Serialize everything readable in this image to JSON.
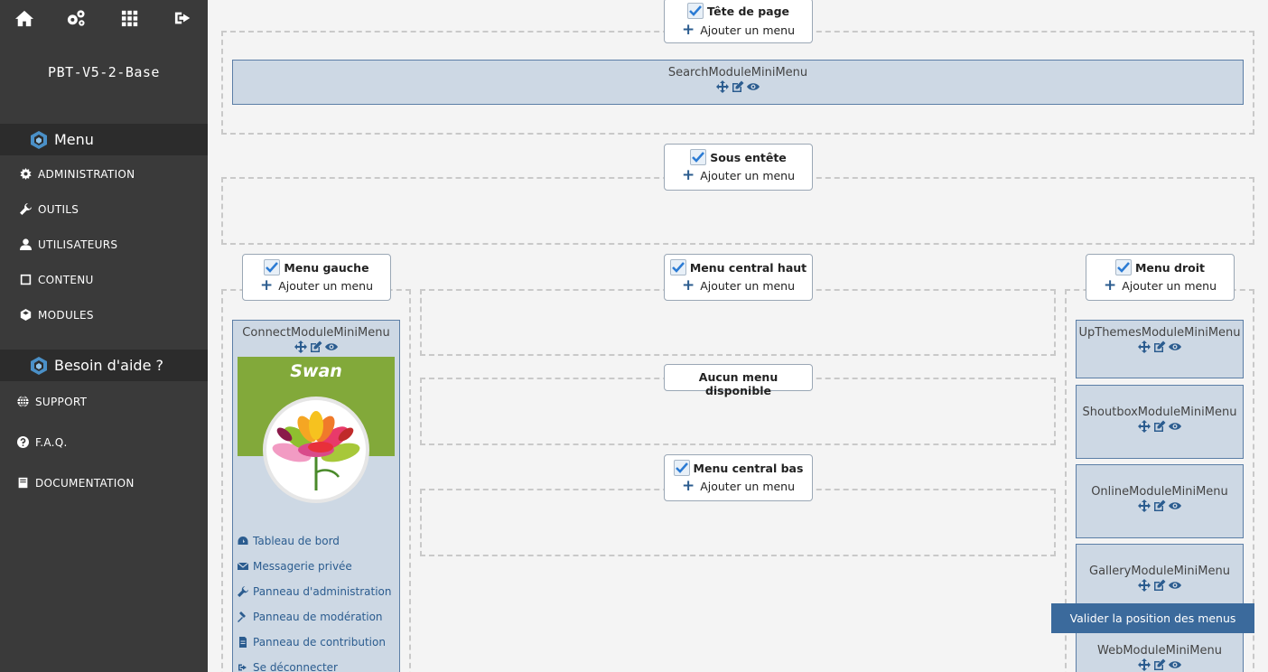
{
  "sidebar": {
    "top_icons": [
      "home-icon",
      "cogs-icon",
      "grid-icon",
      "sign-out-icon"
    ],
    "site_name": "PBT-V5-2-Base",
    "menu_title": "Menu",
    "menu_items": [
      {
        "label": "ADMINISTRATION",
        "icon": "gear-icon"
      },
      {
        "label": "OUTILS",
        "icon": "wrench-icon"
      },
      {
        "label": "UTILISATEURS",
        "icon": "user-icon"
      },
      {
        "label": "CONTENU",
        "icon": "square-icon"
      },
      {
        "label": "MODULES",
        "icon": "cube-icon"
      }
    ],
    "help_title": "Besoin d'aide ?",
    "help_items": [
      {
        "label": "SUPPORT",
        "icon": "globe-icon"
      },
      {
        "label": "F.A.Q.",
        "icon": "question-icon"
      },
      {
        "label": "DOCUMENTATION",
        "icon": "book-icon"
      }
    ]
  },
  "zones": {
    "add_label": "Ajouter un menu",
    "tete": {
      "title": "Tête de page"
    },
    "sous_entete": {
      "title": "Sous entête"
    },
    "gauche": {
      "title": "Menu gauche"
    },
    "central_haut": {
      "title": "Menu central haut"
    },
    "central_bas": {
      "title": "Menu central bas"
    },
    "droit": {
      "title": "Menu droit"
    },
    "no_menu": "Aucun menu disponible"
  },
  "modules": {
    "search": "SearchModuleMiniMenu",
    "connect": "ConnectModuleMiniMenu",
    "upthemes": "UpThemesModuleMiniMenu",
    "shoutbox": "ShoutboxModuleMiniMenu",
    "online": "OnlineModuleMiniMenu",
    "gallery": "GalleryModuleMiniMenu",
    "web": "WebModuleMiniMenu"
  },
  "connect": {
    "theme_name": "Swan",
    "links": [
      {
        "label": "Tableau de bord",
        "icon": "dashboard-icon"
      },
      {
        "label": "Messagerie privée",
        "icon": "envelope-icon"
      },
      {
        "label": "Panneau d'administration",
        "icon": "wrench-icon"
      },
      {
        "label": "Panneau de modération",
        "icon": "gavel-icon"
      },
      {
        "label": "Panneau de contribution",
        "icon": "file-icon"
      },
      {
        "label": "Se déconnecter",
        "icon": "sign-out-icon"
      }
    ]
  },
  "actions": {
    "validate": "Valider la position des menus"
  },
  "colors": {
    "sidebar_bg": "#3a3a3a",
    "module_bg": "#cdd8e4",
    "accent": "#2b5c8f",
    "validate_bg": "#3b6a9c",
    "swan_green": "#82a93a"
  }
}
